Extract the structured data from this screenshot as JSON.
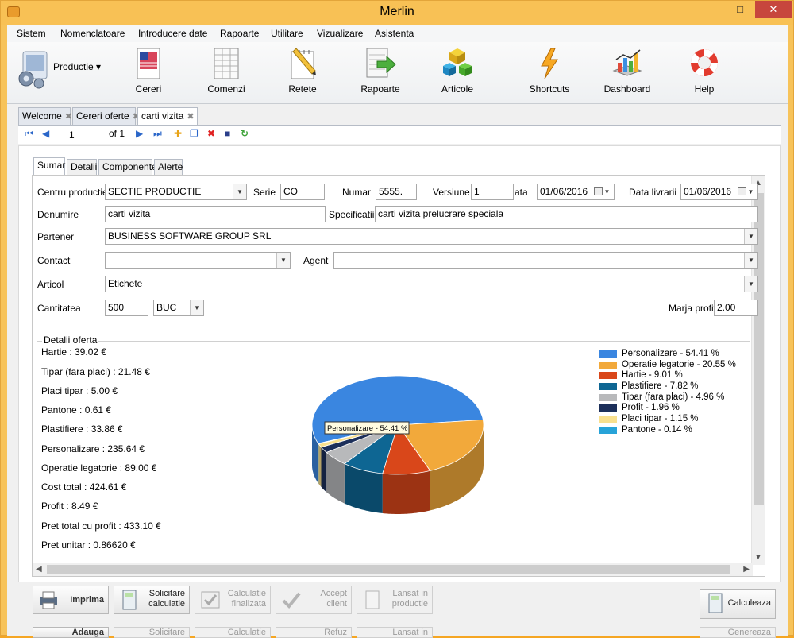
{
  "window": {
    "title": "Merlin",
    "icon": "merlin-app-icon"
  },
  "menu": [
    "Sistem",
    "Nomenclatoare",
    "Introducere date",
    "Rapoarte",
    "Utilitare",
    "Vizualizare",
    "Asistenta"
  ],
  "toolbar": {
    "module_label": "Productie",
    "items": [
      {
        "label": "Cereri",
        "icon": "flag-document-icon"
      },
      {
        "label": "Comenzi",
        "icon": "spreadsheet-document-icon"
      },
      {
        "label": "Retete",
        "icon": "pencil-notebook-icon"
      },
      {
        "label": "Rapoarte",
        "icon": "report-arrow-icon"
      },
      {
        "label": "Articole",
        "icon": "cubes-icon"
      },
      {
        "label": "Shortcuts",
        "icon": "lightning-icon"
      },
      {
        "label": "Dashboard",
        "icon": "bar-chart-icon"
      },
      {
        "label": "Help",
        "icon": "lifebuoy-icon"
      }
    ]
  },
  "doc_tabs": [
    {
      "label": "Welcome"
    },
    {
      "label": "Cereri oferte"
    },
    {
      "label": "carti vizita",
      "active": true
    }
  ],
  "navigator": {
    "current": "1",
    "of_label": "of 1"
  },
  "inner_tabs": [
    "Sumar",
    "Detalii",
    "Componente",
    "Alerte"
  ],
  "form": {
    "centru_label": "Centru productie",
    "centru_value": "SECTIE PRODUCTIE",
    "serie_label": "Serie",
    "serie_value": "CO",
    "numar_label": "Numar",
    "numar_value": "5555.",
    "versiune_label": "Versiune",
    "versiune_value": "1",
    "data_label": "ata",
    "data_value": "01/06/2016",
    "livrarii_label": "Data livrarii",
    "livrarii_value": "01/06/2016",
    "denumire_label": "Denumire",
    "denumire_value": "carti vizita",
    "specificatii_label": "Specificatii",
    "specificatii_value": "carti vizita prelucrare speciala",
    "partener_label": "Partener",
    "partener_value": "BUSINESS SOFTWARE GROUP SRL",
    "contact_label": "Contact",
    "contact_value": "",
    "agent_label": "Agent",
    "agent_value": "",
    "articol_label": "Articol",
    "articol_value": "Etichete",
    "cantitate_label": "Cantitatea",
    "cantitate_value": "500",
    "um_value": "BUC",
    "marja_label": "Marja profit",
    "marja_value": "2.00"
  },
  "details": {
    "title": "Detalii oferta",
    "lines": [
      "Hartie : 39.02 €",
      "Tipar (fara placi) : 21.48 €",
      "Placi tipar : 5.00 €",
      "Pantone : 0.61 €",
      "Plastifiere : 33.86 €",
      "Personalizare : 235.64 €",
      "Operatie legatorie : 89.00 €",
      "Cost total : 424.61 €",
      "Profit : 8.49 €",
      "Pret total cu profit  : 433.10 €",
      "Pret unitar  : 0.86620 €"
    ]
  },
  "chart_data": {
    "type": "pie",
    "title": "",
    "slices": [
      {
        "label": "Personalizare - 54.41 %",
        "value": 54.41,
        "color": "#3a86e0"
      },
      {
        "label": "Operatie legatorie - 20.55 %",
        "value": 20.55,
        "color": "#f2a93b"
      },
      {
        "label": "Hartie - 9.01 %",
        "value": 9.01,
        "color": "#d9471a"
      },
      {
        "label": "Plastifiere - 7.82 %",
        "value": 7.82,
        "color": "#0e6693"
      },
      {
        "label": "Tipar (fara placi) - 4.96 %",
        "value": 4.96,
        "color": "#b8b9bb"
      },
      {
        "label": "Profit - 1.96 %",
        "value": 1.96,
        "color": "#1c2f5a"
      },
      {
        "label": "Placi tipar - 1.15 %",
        "value": 1.15,
        "color": "#f9e08e"
      },
      {
        "label": "Pantone - 0.14 %",
        "value": 0.14,
        "color": "#27a3d8"
      }
    ],
    "data_label": "Personalizare - 54.41 %",
    "legend_position": "right"
  },
  "actions": {
    "imprima": "Imprima",
    "solicitare_1": "Solicitare",
    "solicitare_2": "calculatie",
    "calc_fin_1": "Calculatie",
    "calc_fin_2": "finalizata",
    "accept_1": "Accept",
    "accept_2": "client",
    "lansat_1": "Lansat in",
    "lansat_2": "productie",
    "calculeaza": "Calculeaza",
    "adauga": "Adauga",
    "solicitare_b": "Solicitare",
    "calculatie_b": "Calculatie",
    "refuz": "Refuz",
    "lansat_b": "Lansat in",
    "genereaza": "Genereaza"
  }
}
